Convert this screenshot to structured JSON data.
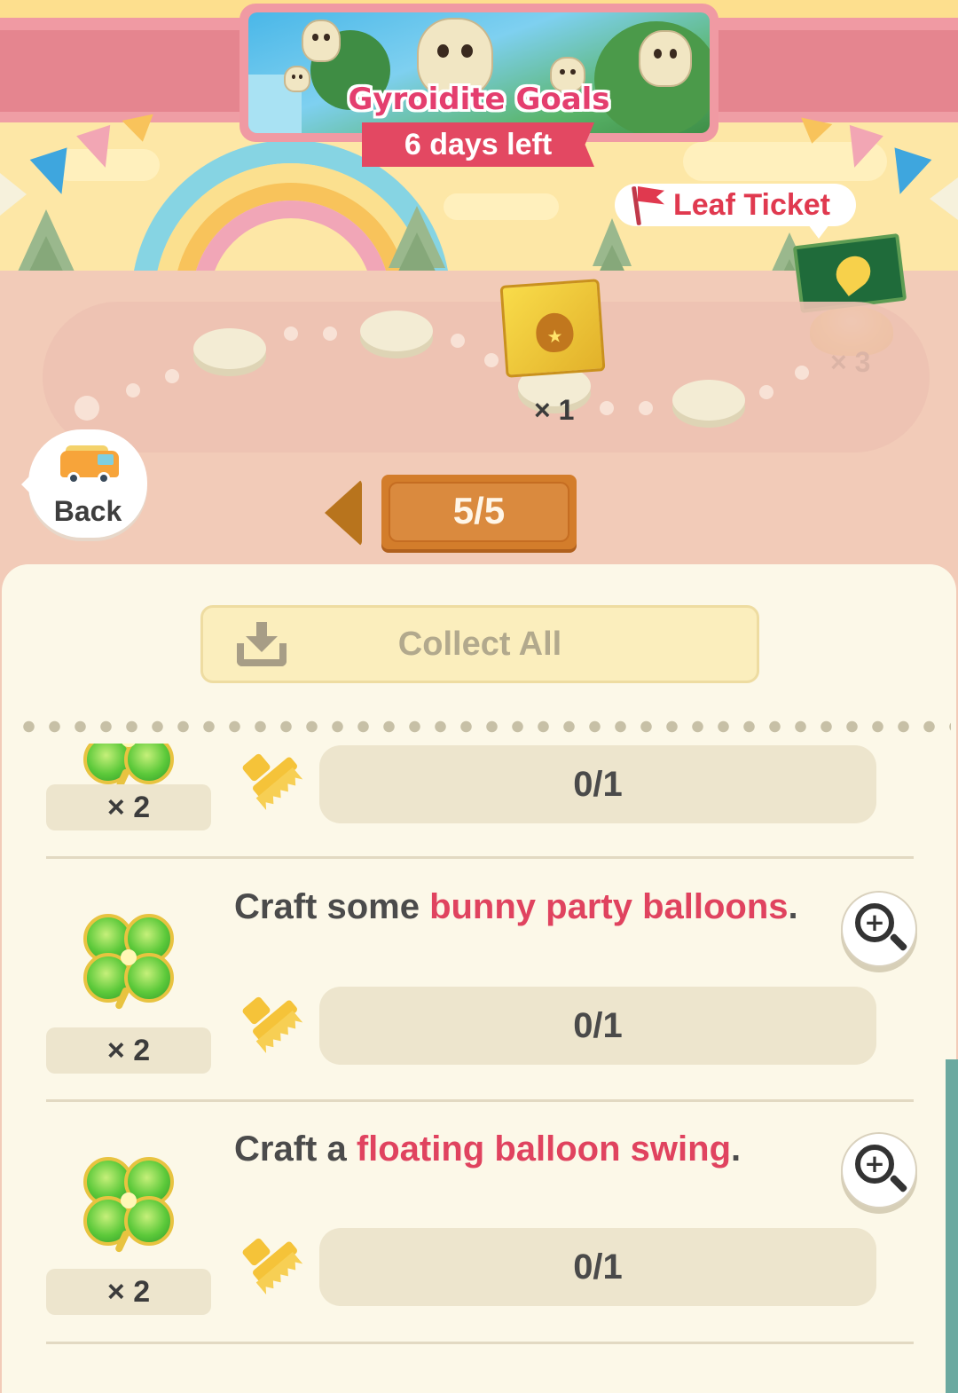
{
  "event": {
    "title": "Gyroidite Goals",
    "days_left": "6 days left"
  },
  "reward_preview": {
    "label": "Leaf Ticket",
    "ticket_quantity": "× 3",
    "map_quantity": "× 1"
  },
  "navigation": {
    "back_label": "Back",
    "page_indicator": "5/5"
  },
  "panel": {
    "collect_all_label": "Collect All",
    "tasks": [
      {
        "text_before": "",
        "highlight": "",
        "text_after": "",
        "reward_icon": "four-leaf-clover-icon",
        "reward_qty": "× 2",
        "progress": "0/1"
      },
      {
        "text_before": "Craft some ",
        "highlight": "bunny party balloons",
        "text_after": ".",
        "reward_icon": "four-leaf-clover-icon",
        "reward_qty": "× 2",
        "progress": "0/1"
      },
      {
        "text_before": "Craft a ",
        "highlight": "floating balloon swing",
        "text_after": ".",
        "reward_icon": "four-leaf-clover-icon",
        "reward_qty": "× 2",
        "progress": "0/1"
      }
    ]
  },
  "colors": {
    "accent_pink": "#e0435f",
    "pager_orange": "#d37d2b",
    "panel_bg": "#fcf8e8"
  }
}
